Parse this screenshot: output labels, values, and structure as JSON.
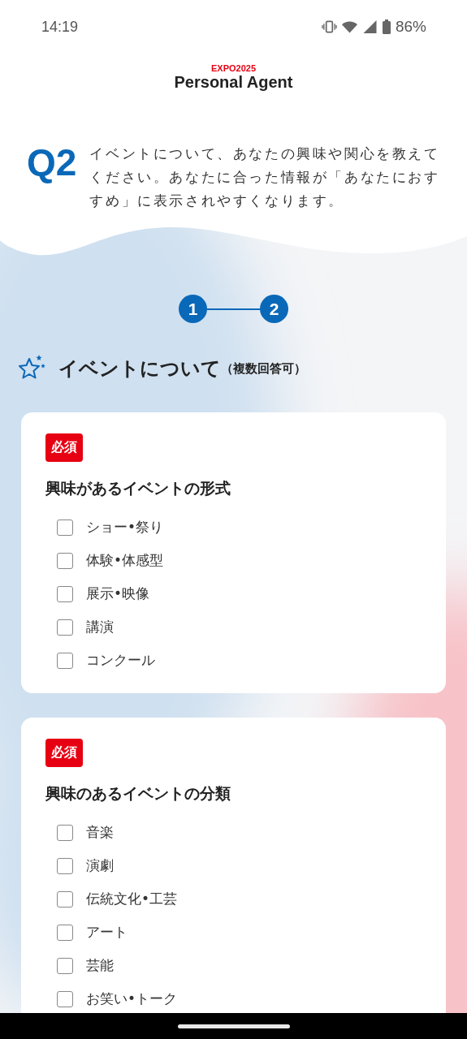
{
  "status_bar": {
    "time": "14:19",
    "battery": "86%"
  },
  "header": {
    "brand": "EXPO2025",
    "title": "Personal Agent"
  },
  "question": {
    "number": "Q2",
    "text": "イベントについて、あなたの興味や関心を教えてください。あなたに合った情報が「あなたにおすすめ」に表示されやすくなります。"
  },
  "steps": [
    {
      "label": "1"
    },
    {
      "label": "2"
    }
  ],
  "section": {
    "title": "イベントについて",
    "note": "（複数回答可）"
  },
  "cards": [
    {
      "badge": "必須",
      "title": "興味があるイベントの形式",
      "options": [
        {
          "label": "ショー•祭り",
          "checked": false
        },
        {
          "label": "体験•体感型",
          "checked": false
        },
        {
          "label": "展示•映像",
          "checked": false
        },
        {
          "label": "講演",
          "checked": false
        },
        {
          "label": "コンクール",
          "checked": false
        }
      ]
    },
    {
      "badge": "必須",
      "title": "興味のあるイベントの分類",
      "options": [
        {
          "label": "音楽",
          "checked": false
        },
        {
          "label": "演劇",
          "checked": false
        },
        {
          "label": "伝統文化•工芸",
          "checked": false
        },
        {
          "label": "アート",
          "checked": false
        },
        {
          "label": "芸能",
          "checked": false
        },
        {
          "label": "お笑い•トーク",
          "checked": false
        }
      ]
    }
  ]
}
